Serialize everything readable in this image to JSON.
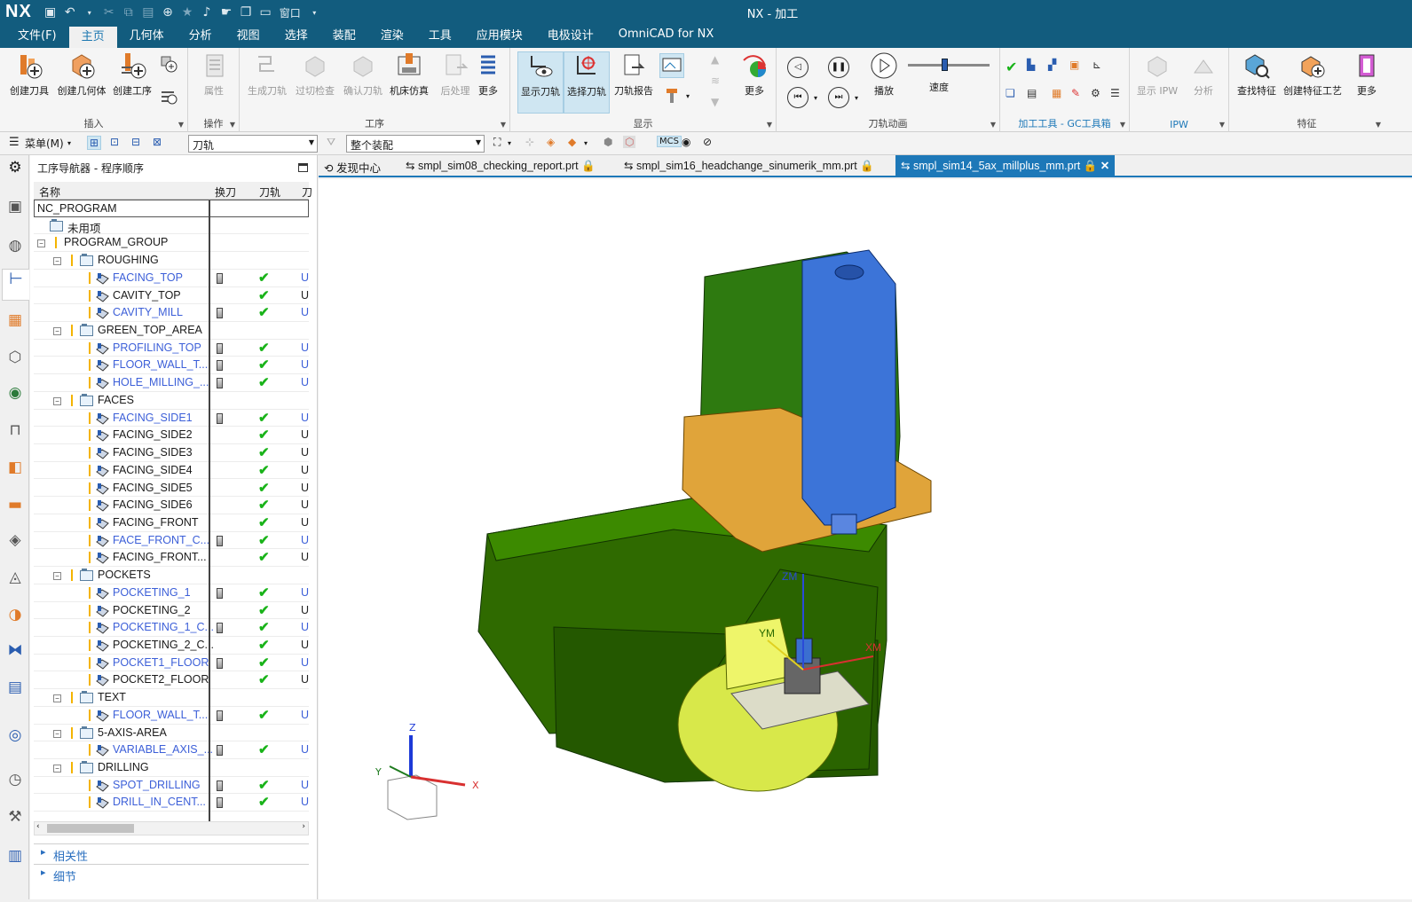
{
  "titlebar": {
    "logo": "NX",
    "title": "NX - 加工",
    "window_menu": "窗口"
  },
  "menubar": [
    "文件(F)",
    "主页",
    "几何体",
    "分析",
    "视图",
    "选择",
    "装配",
    "渲染",
    "工具",
    "应用模块",
    "电极设计",
    "OmniCAD for NX"
  ],
  "ribbon": {
    "insert": {
      "label": "插入",
      "buttons": [
        "创建刀具",
        "创建几何体",
        "创建工序"
      ]
    },
    "ops": {
      "label": "操作",
      "buttons": [
        "属性"
      ]
    },
    "process": {
      "label": "工序",
      "buttons": [
        "生成刀轨",
        "过切检查",
        "确认刀轨",
        "机床仿真",
        "后处理",
        "更多"
      ]
    },
    "display": {
      "label": "显示",
      "buttons": [
        "显示刀轨",
        "选择刀轨",
        "刀轨报告"
      ]
    },
    "more1": "更多",
    "anim": {
      "label": "刀轨动画",
      "play": "播放",
      "speed": "速度"
    },
    "gc": {
      "label": "加工工具 - GC工具箱"
    },
    "ipw": {
      "label": "IPW",
      "buttons": [
        "显示 IPW",
        "分析"
      ]
    },
    "feature": {
      "label": "特征",
      "buttons": [
        "查找特征",
        "创建特征工艺",
        "更多"
      ]
    }
  },
  "toolbar2": {
    "menu": "菜单(M)",
    "filter1": "刀轨",
    "filter2": "整个装配"
  },
  "navigator": {
    "title": "工序导航器 - 程序顺序",
    "columns": [
      "名称",
      "换刀",
      "刀轨",
      "刀"
    ],
    "rows": [
      {
        "name": "NC_PROGRAM",
        "type": "root",
        "depth": 0
      },
      {
        "name": "未用项",
        "type": "folder",
        "depth": 1
      },
      {
        "name": "PROGRAM_GROUP",
        "type": "group",
        "depth": 1
      },
      {
        "name": "ROUGHING",
        "type": "group",
        "depth": 2
      },
      {
        "name": "FACING_TOP",
        "type": "op",
        "depth": 3,
        "blue": true,
        "tool": true,
        "check": true,
        "u": "U"
      },
      {
        "name": "CAVITY_TOP",
        "type": "op",
        "depth": 3,
        "blue": false,
        "tool": false,
        "check": true,
        "u": "U"
      },
      {
        "name": "CAVITY_MILL",
        "type": "op",
        "depth": 3,
        "blue": true,
        "tool": true,
        "check": true,
        "u": "U"
      },
      {
        "name": "GREEN_TOP_AREA",
        "type": "group",
        "depth": 2
      },
      {
        "name": "PROFILING_TOP",
        "type": "op",
        "depth": 3,
        "blue": true,
        "tool": true,
        "check": true,
        "u": "U"
      },
      {
        "name": "FLOOR_WALL_T...",
        "type": "op",
        "depth": 3,
        "blue": true,
        "tool": true,
        "check": true,
        "u": "U"
      },
      {
        "name": "HOLE_MILLING_...",
        "type": "op",
        "depth": 3,
        "blue": true,
        "tool": true,
        "check": true,
        "u": "U"
      },
      {
        "name": "FACES",
        "type": "group",
        "depth": 2
      },
      {
        "name": "FACING_SIDE1",
        "type": "op",
        "depth": 3,
        "blue": true,
        "tool": true,
        "check": true,
        "u": "U"
      },
      {
        "name": "FACING_SIDE2",
        "type": "op",
        "depth": 3,
        "blue": false,
        "tool": false,
        "check": true,
        "u": "U"
      },
      {
        "name": "FACING_SIDE3",
        "type": "op",
        "depth": 3,
        "blue": false,
        "tool": false,
        "check": true,
        "u": "U"
      },
      {
        "name": "FACING_SIDE4",
        "type": "op",
        "depth": 3,
        "blue": false,
        "tool": false,
        "check": true,
        "u": "U"
      },
      {
        "name": "FACING_SIDE5",
        "type": "op",
        "depth": 3,
        "blue": false,
        "tool": false,
        "check": true,
        "u": "U"
      },
      {
        "name": "FACING_SIDE6",
        "type": "op",
        "depth": 3,
        "blue": false,
        "tool": false,
        "check": true,
        "u": "U"
      },
      {
        "name": "FACING_FRONT",
        "type": "op",
        "depth": 3,
        "blue": false,
        "tool": false,
        "check": true,
        "u": "U"
      },
      {
        "name": "FACE_FRONT_C...",
        "type": "op",
        "depth": 3,
        "blue": true,
        "tool": true,
        "check": true,
        "u": "U"
      },
      {
        "name": "FACING_FRONT...",
        "type": "op",
        "depth": 3,
        "blue": false,
        "tool": false,
        "check": true,
        "u": "U"
      },
      {
        "name": "POCKETS",
        "type": "group",
        "depth": 2
      },
      {
        "name": "POCKETING_1",
        "type": "op",
        "depth": 3,
        "blue": true,
        "tool": true,
        "check": true,
        "u": "U"
      },
      {
        "name": "POCKETING_2",
        "type": "op",
        "depth": 3,
        "blue": false,
        "tool": false,
        "check": true,
        "u": "U"
      },
      {
        "name": "POCKETING_1_C...",
        "type": "op",
        "depth": 3,
        "blue": true,
        "tool": true,
        "check": true,
        "u": "U"
      },
      {
        "name": "POCKETING_2_C...",
        "type": "op",
        "depth": 3,
        "blue": false,
        "tool": false,
        "check": true,
        "u": "U"
      },
      {
        "name": "POCKET1_FLOOR",
        "type": "op",
        "depth": 3,
        "blue": true,
        "tool": true,
        "check": true,
        "u": "U"
      },
      {
        "name": "POCKET2_FLOOR",
        "type": "op",
        "depth": 3,
        "blue": false,
        "tool": false,
        "check": true,
        "u": "U"
      },
      {
        "name": "TEXT",
        "type": "group",
        "depth": 2
      },
      {
        "name": "FLOOR_WALL_T...",
        "type": "op",
        "depth": 3,
        "blue": true,
        "tool": true,
        "check": true,
        "u": "U"
      },
      {
        "name": "5-AXIS-AREA",
        "type": "group",
        "depth": 2
      },
      {
        "name": "VARIABLE_AXIS_...",
        "type": "op",
        "depth": 3,
        "blue": true,
        "tool": true,
        "check": true,
        "u": "U"
      },
      {
        "name": "DRILLING",
        "type": "group",
        "depth": 2
      },
      {
        "name": "SPOT_DRILLING",
        "type": "op",
        "depth": 3,
        "blue": true,
        "tool": true,
        "check": true,
        "u": "U"
      },
      {
        "name": "DRILL_IN_CENT...",
        "type": "op",
        "depth": 3,
        "blue": true,
        "tool": true,
        "check": true,
        "u": "U"
      }
    ]
  },
  "accordions": [
    "相关性",
    "细节"
  ],
  "tabs": [
    "发现中心",
    "smpl_sim08_checking_report.prt",
    "smpl_sim16_headchange_sinumerik_mm.prt",
    "smpl_sim14_5ax_millplus_mm.prt"
  ],
  "viewport": {
    "axis_labels": {
      "zm": "ZM",
      "ym": "YM",
      "xm": "XM",
      "z": "Z",
      "y": "Y",
      "x": "X"
    }
  }
}
